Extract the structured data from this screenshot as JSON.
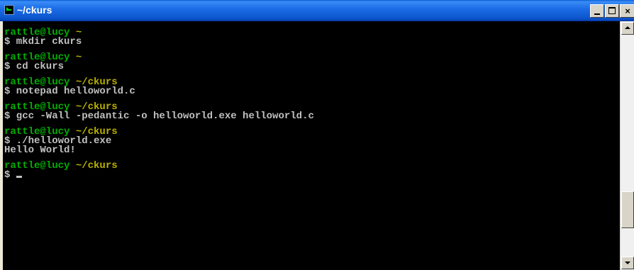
{
  "window": {
    "title": "~/ckurs"
  },
  "title_buttons": {
    "minimize": "_",
    "maximize": "□",
    "close": "×"
  },
  "terminal": {
    "entries": [
      {
        "user": "rattle@lucy",
        "path": "~",
        "command": "$ mkdir ckurs",
        "output": ""
      },
      {
        "user": "rattle@lucy",
        "path": "~",
        "command": "$ cd ckurs",
        "output": ""
      },
      {
        "user": "rattle@lucy",
        "path": "~/ckurs",
        "command": "$ notepad helloworld.c",
        "output": ""
      },
      {
        "user": "rattle@lucy",
        "path": "~/ckurs",
        "command": "$ gcc -Wall -pedantic -o helloworld.exe helloworld.c",
        "output": ""
      },
      {
        "user": "rattle@lucy",
        "path": "~/ckurs",
        "command": "$ ./helloworld.exe",
        "output": "Hello World!"
      },
      {
        "user": "rattle@lucy",
        "path": "~/ckurs",
        "command": "$ ",
        "output": ""
      }
    ]
  },
  "colors": {
    "prompt_user": "#00b000",
    "prompt_path": "#b8b000",
    "text": "#c0c0c0",
    "background": "#000000"
  }
}
